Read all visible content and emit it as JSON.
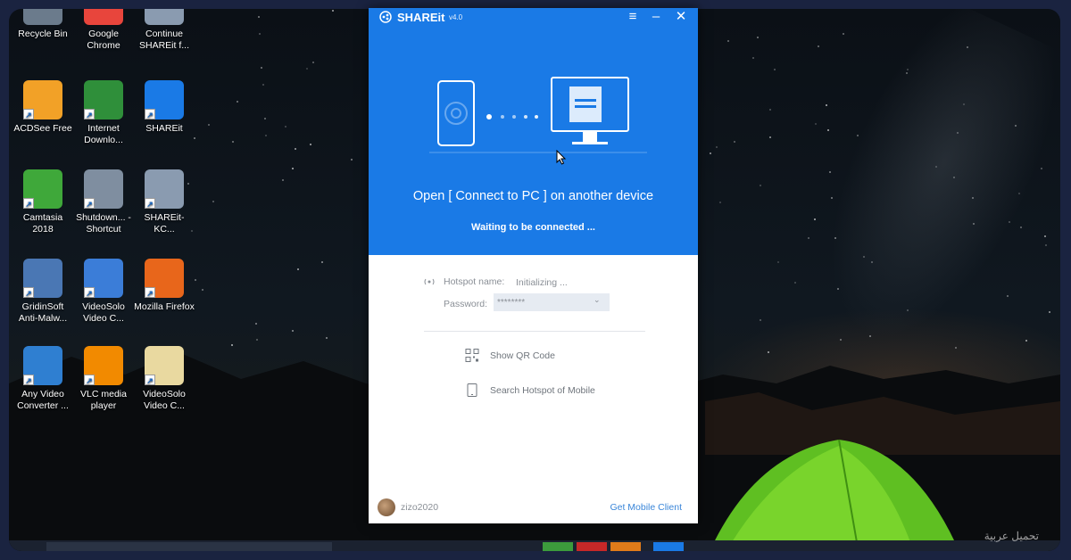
{
  "desktop": {
    "icons": [
      {
        "label": "Recycle Bin",
        "icon": "recycle-bin-icon",
        "color": "#6b7b8c"
      },
      {
        "label": "Google Chrome",
        "icon": "chrome-icon",
        "color": "#e8453c"
      },
      {
        "label": "Continue SHAREit f...",
        "icon": "shareit-setup-icon",
        "color": "#8a9bb0"
      },
      {
        "label": "ACDSee Free",
        "icon": "acdsee-icon",
        "color": "#f2a127"
      },
      {
        "label": "Internet Downlo...",
        "icon": "idm-icon",
        "color": "#2f8f3a"
      },
      {
        "label": "SHAREit",
        "icon": "shareit-icon",
        "color": "#1a7ae6"
      },
      {
        "label": "Camtasia 2018",
        "icon": "camtasia-icon",
        "color": "#3fa83a"
      },
      {
        "label": "Shutdown... - Shortcut",
        "icon": "shutdown-shortcut-icon",
        "color": "#7f8ea0"
      },
      {
        "label": "SHAREit-KC...",
        "icon": "shareit-kc-icon",
        "color": "#8a9bb0"
      },
      {
        "label": "GridinSoft Anti-Malw...",
        "icon": "gridinsoft-icon",
        "color": "#4a77b4"
      },
      {
        "label": "VideoSolo Video C...",
        "icon": "videosolo-icon",
        "color": "#3b7dd8"
      },
      {
        "label": "Mozilla Firefox",
        "icon": "firefox-icon",
        "color": "#e8661b"
      },
      {
        "label": "Any Video Converter ...",
        "icon": "any-video-converter-icon",
        "color": "#2f7fd1"
      },
      {
        "label": "VLC media player",
        "icon": "vlc-icon",
        "color": "#f28a00"
      },
      {
        "label": "VideoSolo Video C...",
        "icon": "folder-icon",
        "color": "#e9d9a0"
      }
    ]
  },
  "window": {
    "title": "SHAREit",
    "version": "v4.0",
    "menu_icon": "hamburger-menu-icon",
    "minimize_icon": "minimize-icon",
    "close_icon": "close-icon",
    "headline": "Open [ Connect to PC ] on another device",
    "status": "Waiting to be connected ...",
    "hotspot_label": "Hotspot name:",
    "hotspot_value": "Initializing ...",
    "password_label": "Password:",
    "password_value": "********",
    "actions": [
      {
        "label": "Show QR Code",
        "icon": "qr-code-icon"
      },
      {
        "label": "Search Hotspot of Mobile",
        "icon": "mobile-phone-icon"
      }
    ],
    "username": "zizo2020",
    "get_mobile_link": "Get Mobile Client",
    "accent": "#1a7ae6"
  },
  "watermark": "تحميل عربية"
}
